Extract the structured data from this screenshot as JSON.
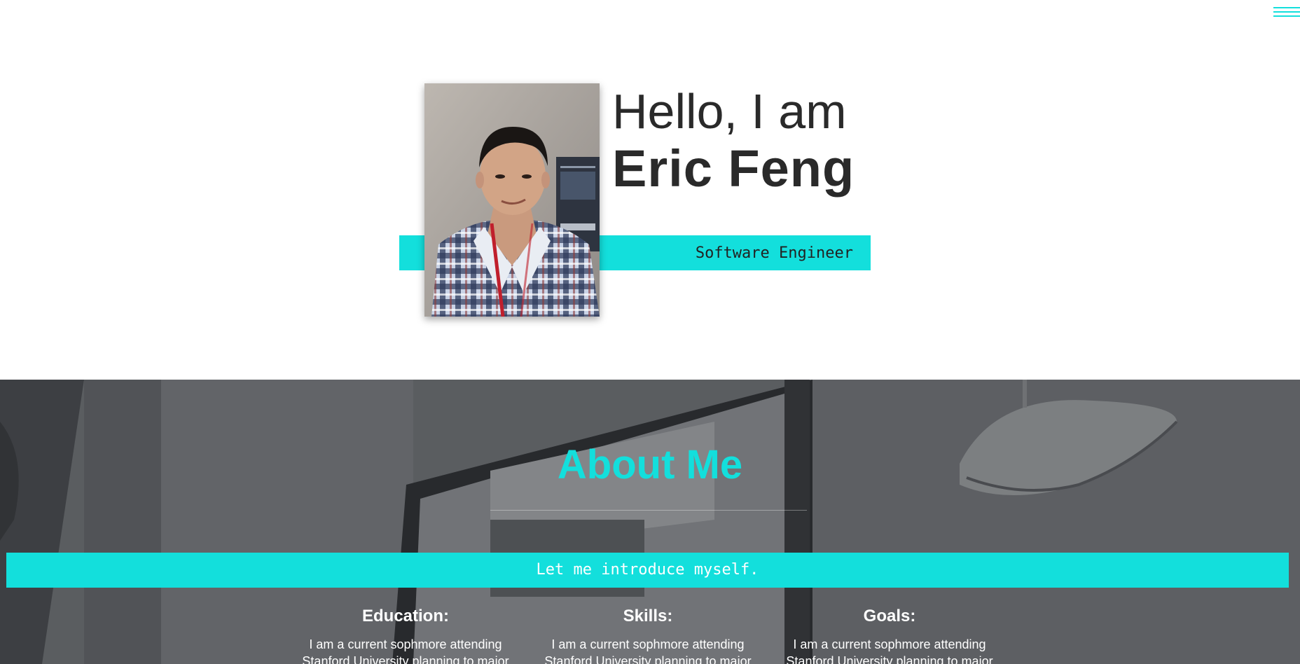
{
  "nav": {
    "menu_icon": "hamburger-menu-icon",
    "accent_color": "#13dfdc"
  },
  "hero": {
    "greeting": "Hello, I am",
    "name": "Eric Feng",
    "role": "Software Engineer",
    "photo_icon": "profile-photo"
  },
  "about": {
    "title": "About Me",
    "intro": "Let me introduce myself.",
    "columns": [
      {
        "heading": "Education:",
        "text": "I am a current sophmore attending Stanford University planning to major"
      },
      {
        "heading": "Skills:",
        "text": "I am a current sophmore attending Stanford University planning to major"
      },
      {
        "heading": "Goals:",
        "text": "I am a current sophmore attending Stanford University planning to major"
      }
    ]
  }
}
